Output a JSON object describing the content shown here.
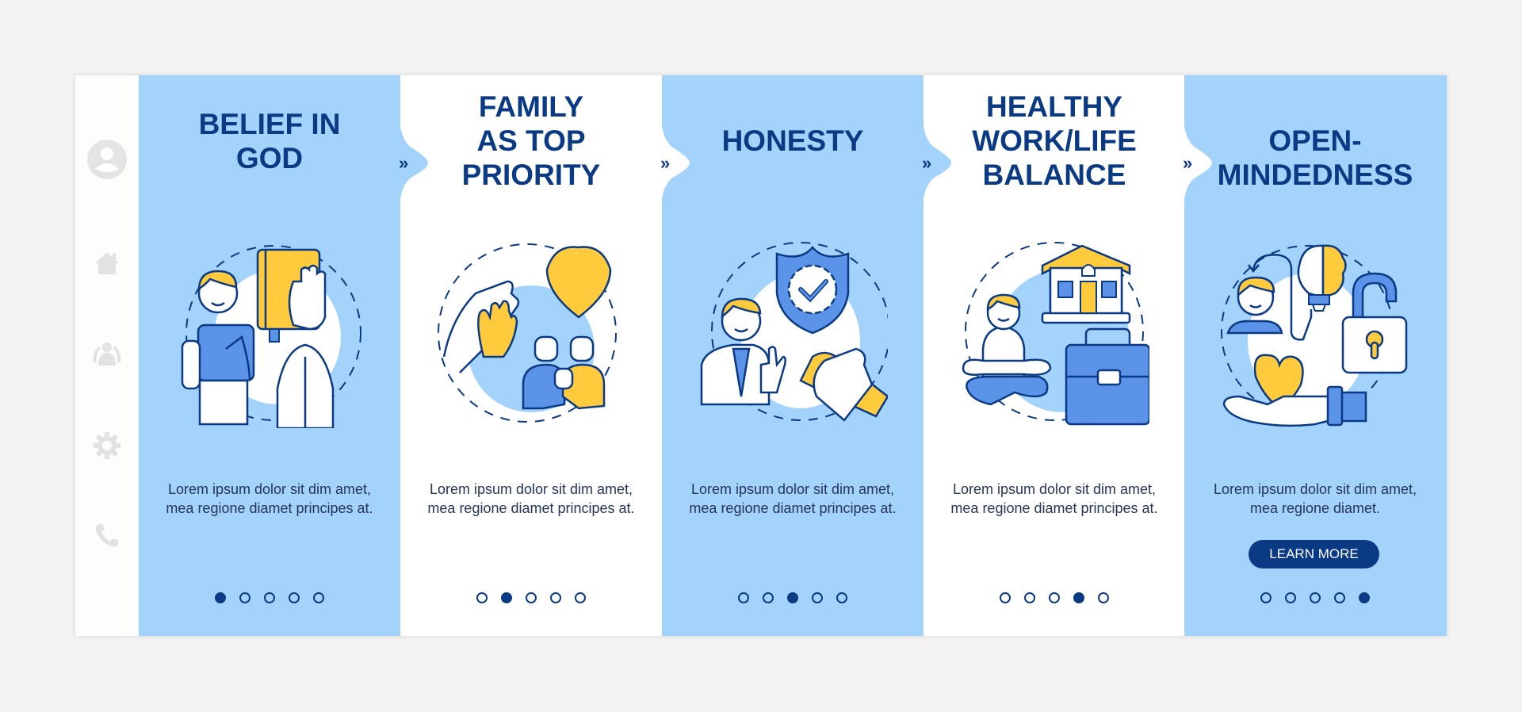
{
  "colors": {
    "panel_blue": "#a3d2fb",
    "navy": "#0b3a84",
    "yellow": "#ffcb3d",
    "mid_blue": "#5b93e8",
    "sidebar_icon": "#e2e2e2"
  },
  "sidebar": {
    "icons": [
      "user-icon",
      "home-icon",
      "group-icon",
      "gear-icon",
      "phone-icon"
    ]
  },
  "next_arrow": "»",
  "panels": [
    {
      "title_lines": [
        "BELIEF IN",
        "GOD"
      ],
      "illustration": "man-with-bible-and-praying-hands",
      "description": "Lorem ipsum dolor sit dim amet, mea regione diamet principes at.",
      "active_dot": 1,
      "total_dots": 5
    },
    {
      "title_lines": [
        "FAMILY",
        "AS TOP",
        "PRIORITY"
      ],
      "illustration": "hands-heart-family",
      "description": "Lorem ipsum dolor sit dim amet, mea regione diamet principes at.",
      "active_dot": 2,
      "total_dots": 5
    },
    {
      "title_lines": [
        "HONESTY"
      ],
      "illustration": "man-shield-handshake",
      "description": "Lorem ipsum dolor sit dim amet, mea regione diamet principes at.",
      "active_dot": 3,
      "total_dots": 5
    },
    {
      "title_lines": [
        "HEALTHY",
        "WORK/LIFE",
        "BALANCE"
      ],
      "illustration": "meditating-man-house-briefcase",
      "description": "Lorem ipsum dolor sit dim amet, mea regione diamet principes at.",
      "active_dot": 4,
      "total_dots": 5
    },
    {
      "title_lines": [
        "OPEN-",
        "MINDEDNESS"
      ],
      "illustration": "person-bulb-lock-heart",
      "description": "Lorem ipsum dolor sit dim amet, mea regione diamet.",
      "active_dot": 5,
      "total_dots": 5,
      "button_label": "LEARN MORE"
    }
  ]
}
